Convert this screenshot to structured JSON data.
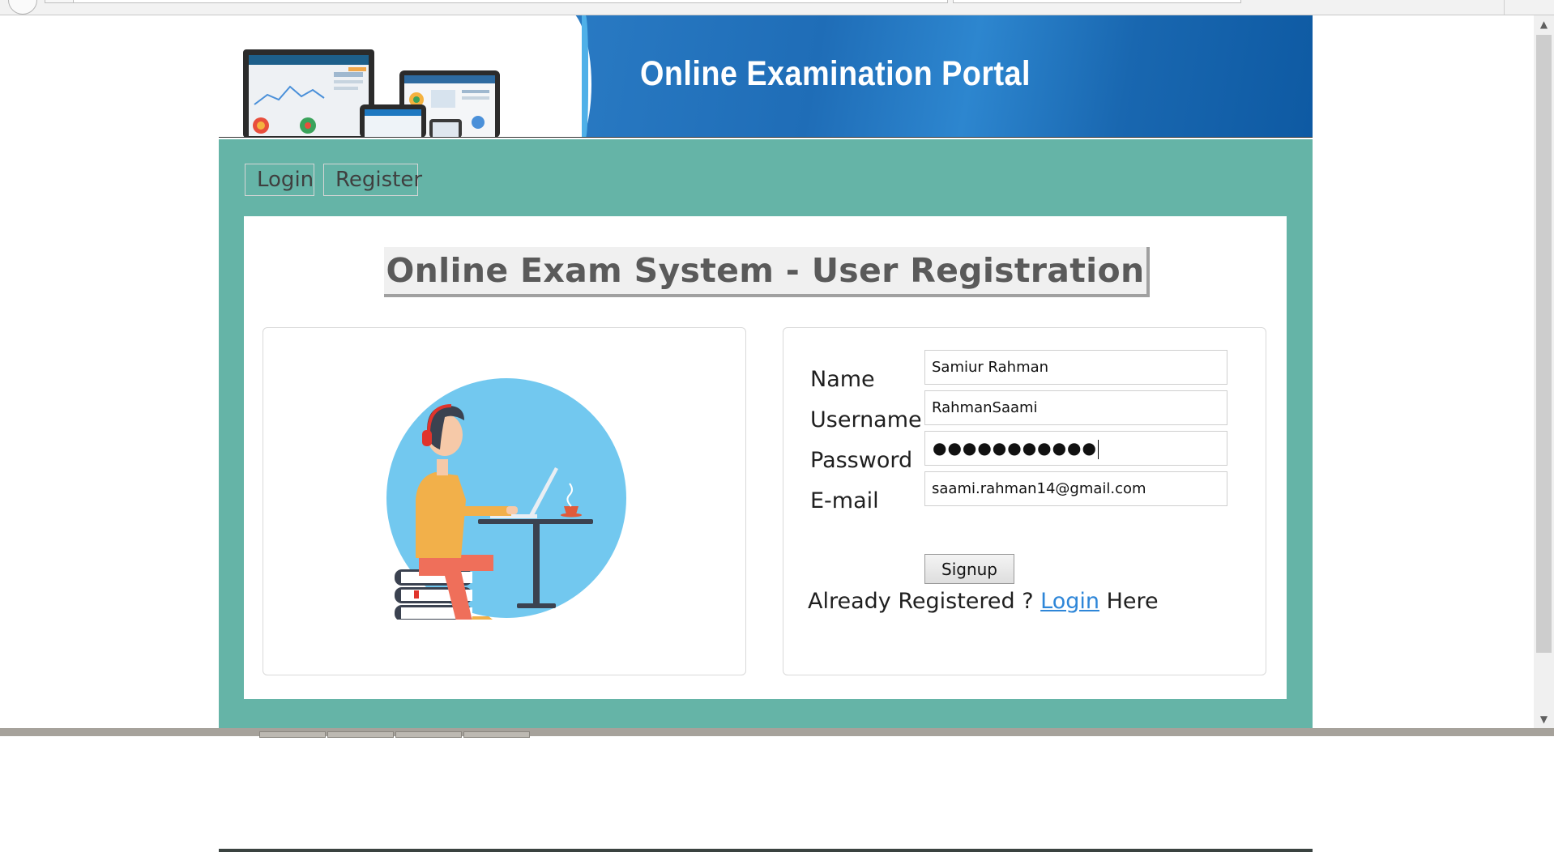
{
  "banner": {
    "title": "Online Examination Portal"
  },
  "nav": {
    "login_label": "Login",
    "register_label": "Register"
  },
  "registration": {
    "heading": "Online Exam System - User Registration",
    "fields": {
      "name": {
        "label": "Name",
        "value": "Samiur Rahman"
      },
      "username": {
        "label": "Username",
        "value": "RahmanSaami"
      },
      "password": {
        "label": "Password",
        "masked_value": "●●●●●●●●●●●"
      },
      "email": {
        "label": "E-mail",
        "value": "saami.rahman14@gmail.com"
      }
    },
    "signup_label": "Signup",
    "already_prefix": "Already Registered ? ",
    "already_link": "Login",
    "already_suffix": " Here"
  },
  "colors": {
    "teal_background": "#65b4a7",
    "banner_blue": "#1f6db7",
    "link_blue": "#2e86d8",
    "illustration_circle": "#72c8ef"
  },
  "icons": {
    "banner_art": "devices-illustration",
    "panel_art": "student-at-laptop-illustration"
  }
}
